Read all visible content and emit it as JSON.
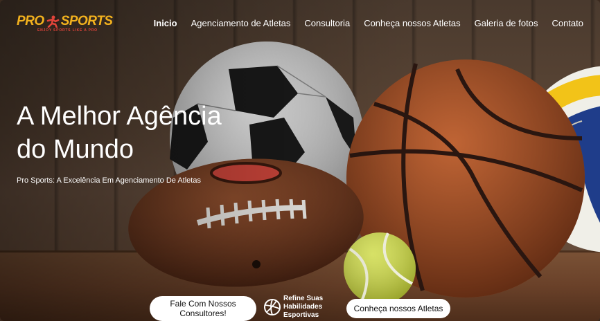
{
  "header": {
    "logo_text_left": "PRO",
    "logo_text_right": "SPORTS",
    "logo_tagline": "ENJOY SPORTS LIKE A PRO"
  },
  "nav": {
    "items": [
      {
        "label": "Inicio",
        "active": true
      },
      {
        "label": "Agenciamento de Atletas",
        "active": false
      },
      {
        "label": "Consultoria",
        "active": false
      },
      {
        "label": "Conheça nossos Atletas",
        "active": false
      },
      {
        "label": "Galeria de fotos",
        "active": false
      },
      {
        "label": "Contato",
        "active": false
      }
    ]
  },
  "hero": {
    "title_line1": "A Melhor Agência",
    "title_line2": "do Mundo",
    "subtitle": "Pro Sports: A Excelência Em Agenciamento De Atletas"
  },
  "cta": {
    "primary_line1": "Fale Com Nossos",
    "primary_line2": "Consultores!",
    "badge_line1": "Refine Suas",
    "badge_line2": "Habilidades",
    "badge_line3": "Esportivas",
    "secondary": "Conheça nossos Atletas"
  },
  "colors": {
    "brand_gold": "#f3b21e",
    "brand_red": "#e2443a",
    "button_bg": "#ffffff",
    "text_light": "#ffffff"
  }
}
